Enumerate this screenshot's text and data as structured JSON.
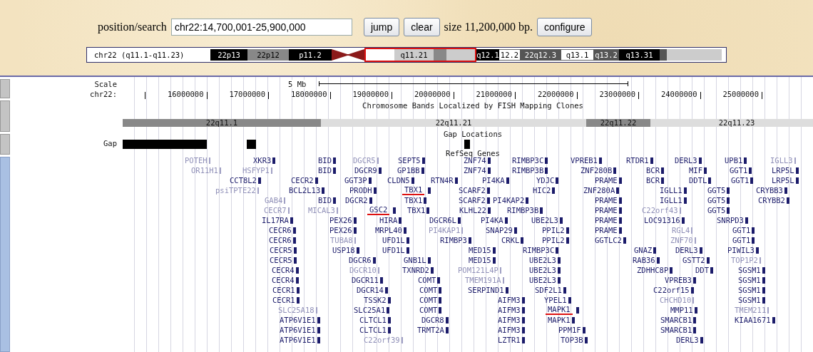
{
  "position_bar": {
    "label": "position/search",
    "value": "chr22:14,700,001-25,900,000",
    "buttons": [
      "jump",
      "clear"
    ],
    "size_text": "size 11,200,000 bp.",
    "configure_button": "configure"
  },
  "ideogram": {
    "label": "chr22 (q11.1-q11.23)",
    "bands": [
      {
        "kind": "band",
        "label": "22p13",
        "color": "#000000"
      },
      {
        "kind": "band",
        "label": "22p12",
        "color": "#888888"
      },
      {
        "kind": "band",
        "label": "p11.2",
        "color": "#000000"
      },
      {
        "kind": "centromere",
        "color": "#8b1a1a"
      },
      {
        "kind": "frame",
        "color": "#dd1111",
        "bands": [
          {
            "label": "q11.21",
            "color": "#cccccc"
          },
          {
            "color": "#888888"
          },
          {
            "color": "#cccccc"
          }
        ]
      },
      {
        "kind": "band",
        "label": "q12.1",
        "color": "#000000"
      },
      {
        "kind": "band",
        "label": "12.2",
        "color": "#ffffff"
      },
      {
        "kind": "band",
        "label": "22q12.3",
        "color": "#555555"
      },
      {
        "kind": "band",
        "label": "q13.1",
        "color": "#ffffff"
      },
      {
        "kind": "band",
        "label": "q13.2",
        "color": "#555555"
      },
      {
        "kind": "band",
        "label": "q13.31",
        "color": "#000000"
      },
      {
        "kind": "band",
        "color": "#555555"
      },
      {
        "kind": "band",
        "color": "#cccccc"
      }
    ]
  },
  "ruler": {
    "scale_label": "Scale",
    "scale_text": "5 Mb",
    "chrom_label": "chr22:",
    "ticks": [
      "16000000",
      "17000000",
      "18000000",
      "19000000",
      "20000000",
      "21000000",
      "22000000",
      "23000000",
      "24000000",
      "25000000"
    ]
  },
  "bands_track": {
    "title": "Chromosome Bands Localized by FISH Mapping Clones",
    "bands": [
      {
        "label": "22q11.1",
        "color": "#888888"
      },
      {
        "label": "22q11.21",
        "color": "#dddddd"
      },
      {
        "label": "22q11.22",
        "color": "#888888"
      },
      {
        "label": "22q11.23",
        "color": "#dddddd"
      }
    ]
  },
  "gap_track": {
    "title": "Gap Locations",
    "label": "Gap"
  },
  "genes_track": {
    "title": "RefSeq Genes",
    "rows": [
      [
        {
          "name": "POTEH",
          "faded": true,
          "marked": false
        },
        {
          "name": "XKR3",
          "faded": false,
          "marked": false
        },
        {
          "name": "BID",
          "faded": false,
          "marked": false
        },
        {
          "name": "DGCR5",
          "faded": true,
          "marked": false
        },
        {
          "name": "SEPT5",
          "faded": false,
          "marked": false
        },
        {
          "name": "ZNF74",
          "faded": false,
          "marked": false
        },
        {
          "name": "RIMBP3C",
          "faded": false,
          "marked": false
        },
        {
          "name": "VPREB1",
          "faded": false,
          "marked": false
        },
        {
          "name": "RTDR1",
          "faded": false,
          "marked": false
        },
        {
          "name": "DERL3",
          "faded": false,
          "marked": false
        },
        {
          "name": "UPB1",
          "faded": false,
          "marked": false
        },
        {
          "name": "IGLL3",
          "faded": true,
          "marked": false
        }
      ],
      [
        {
          "name": "OR11H1",
          "faded": true,
          "marked": false
        },
        {
          "name": "HSFYP1",
          "faded": true,
          "marked": false
        },
        {
          "name": "BID",
          "faded": false,
          "marked": false
        },
        {
          "name": "DGCR9",
          "faded": false,
          "marked": false
        },
        {
          "name": "GP1BB",
          "faded": false,
          "marked": false
        },
        {
          "name": "ZNF74",
          "faded": false,
          "marked": false
        },
        {
          "name": "RIMBP3B",
          "faded": false,
          "marked": false
        },
        {
          "name": "ZNF280B",
          "faded": false,
          "marked": false
        },
        {
          "name": "BCR",
          "faded": false,
          "marked": false
        },
        {
          "name": "MIF",
          "faded": false,
          "marked": false
        },
        {
          "name": "GGT1",
          "faded": false,
          "marked": false
        },
        {
          "name": "LRP5L",
          "faded": false,
          "marked": false
        }
      ],
      [
        {
          "name": "CCT8L2",
          "faded": false,
          "marked": false
        },
        {
          "name": "CECR2",
          "faded": false,
          "marked": false
        },
        {
          "name": "GGT3P",
          "faded": false,
          "marked": false
        },
        {
          "name": "CLDN5",
          "faded": false,
          "marked": false
        },
        {
          "name": "RTN4R",
          "faded": false,
          "marked": false
        },
        {
          "name": "PI4KA",
          "faded": false,
          "marked": false
        },
        {
          "name": "YDJC",
          "faded": false,
          "marked": false
        },
        {
          "name": "PRAME",
          "faded": false,
          "marked": false
        },
        {
          "name": "BCR",
          "faded": false,
          "marked": false
        },
        {
          "name": "DDTL",
          "faded": false,
          "marked": false
        },
        {
          "name": "GGT1",
          "faded": false,
          "marked": false
        },
        {
          "name": "LRP5L",
          "faded": false,
          "marked": false
        }
      ],
      [
        {
          "name": "psiTPTE22",
          "faded": true,
          "marked": false
        },
        {
          "name": "BCL2L13",
          "faded": false,
          "marked": false
        },
        {
          "name": "PRODH",
          "faded": false,
          "marked": false
        },
        {
          "name": "TBX1",
          "faded": false,
          "marked": true
        },
        {
          "name": "SCARF2",
          "faded": false,
          "marked": false
        },
        {
          "name": "HIC2",
          "faded": false,
          "marked": false
        },
        {
          "name": "ZNF280A",
          "faded": false,
          "marked": false
        },
        {
          "name": "IGLL1",
          "faded": false,
          "marked": false
        },
        {
          "name": "GGT5",
          "faded": false,
          "marked": false
        },
        {
          "name": "CRYBB3",
          "faded": false,
          "marked": false
        }
      ],
      [
        {
          "name": "GAB4",
          "faded": true,
          "marked": false
        },
        {
          "name": "BID",
          "faded": false,
          "marked": false
        },
        {
          "name": "DGCR2",
          "faded": false,
          "marked": false
        },
        {
          "name": "TBX1",
          "faded": false,
          "marked": false
        },
        {
          "name": "SCARF2",
          "faded": false,
          "marked": false
        },
        {
          "name": "PI4KAP2",
          "faded": false,
          "marked": false
        },
        {
          "name": "PRAME",
          "faded": false,
          "marked": false
        },
        {
          "name": "IGLL1",
          "faded": false,
          "marked": false
        },
        {
          "name": "GGT5",
          "faded": false,
          "marked": false
        },
        {
          "name": "CRYBB2",
          "faded": false,
          "marked": false
        }
      ],
      [
        {
          "name": "CECR7",
          "faded": true,
          "marked": false
        },
        {
          "name": "MICAL3",
          "faded": true,
          "marked": false
        },
        {
          "name": "GSC2",
          "faded": false,
          "marked": true
        },
        {
          "name": "TBX1",
          "faded": false,
          "marked": false
        },
        {
          "name": "KLHL22",
          "faded": false,
          "marked": false
        },
        {
          "name": "RIMBP3B",
          "faded": false,
          "marked": false
        },
        {
          "name": "PRAME",
          "faded": false,
          "marked": false
        },
        {
          "name": "C22orf43",
          "faded": true,
          "marked": false
        },
        {
          "name": "GGT5",
          "faded": false,
          "marked": false
        }
      ],
      [
        {
          "name": "IL17RA",
          "faded": false,
          "marked": false
        },
        {
          "name": "PEX26",
          "faded": false,
          "marked": false
        },
        {
          "name": "HIRA",
          "faded": false,
          "marked": false
        },
        {
          "name": "DGCR6L",
          "faded": false,
          "marked": false
        },
        {
          "name": "PI4KA",
          "faded": false,
          "marked": false
        },
        {
          "name": "UBE2L3",
          "faded": false,
          "marked": false
        },
        {
          "name": "PRAME",
          "faded": false,
          "marked": false
        },
        {
          "name": "LOC91316",
          "faded": false,
          "marked": false
        },
        {
          "name": "SNRPD3",
          "faded": false,
          "marked": false
        }
      ],
      [
        {
          "name": "CECR6",
          "faded": false,
          "marked": false
        },
        {
          "name": "PEX26",
          "faded": false,
          "marked": false
        },
        {
          "name": "MRPL40",
          "faded": false,
          "marked": false
        },
        {
          "name": "PI4KAP1",
          "faded": true,
          "marked": false
        },
        {
          "name": "SNAP29",
          "faded": false,
          "marked": false
        },
        {
          "name": "PPIL2",
          "faded": false,
          "marked": false
        },
        {
          "name": "PRAME",
          "faded": false,
          "marked": false
        },
        {
          "name": "RGL4",
          "faded": true,
          "marked": false
        },
        {
          "name": "GGT1",
          "faded": false,
          "marked": false
        }
      ],
      [
        {
          "name": "CECR6",
          "faded": false,
          "marked": false
        },
        {
          "name": "TUBA8",
          "faded": true,
          "marked": false
        },
        {
          "name": "UFD1L",
          "faded": false,
          "marked": false
        },
        {
          "name": "RIMBP3",
          "faded": false,
          "marked": false
        },
        {
          "name": "CRKL",
          "faded": false,
          "marked": false
        },
        {
          "name": "PPIL2",
          "faded": false,
          "marked": false
        },
        {
          "name": "GGTLC2",
          "faded": false,
          "marked": false
        },
        {
          "name": "ZNF70",
          "faded": true,
          "marked": false
        },
        {
          "name": "GGT1",
          "faded": false,
          "marked": false
        }
      ],
      [
        {
          "name": "CECR5",
          "faded": false,
          "marked": false
        },
        {
          "name": "USP18",
          "faded": false,
          "marked": false
        },
        {
          "name": "UFD1L",
          "faded": false,
          "marked": false
        },
        {
          "name": "MED15",
          "faded": false,
          "marked": false
        },
        {
          "name": "RIMBP3C",
          "faded": false,
          "marked": false
        },
        {
          "name": "GNAZ",
          "faded": false,
          "marked": false
        },
        {
          "name": "DERL3",
          "faded": false,
          "marked": false
        },
        {
          "name": "PIWIL3",
          "faded": false,
          "marked": false
        }
      ],
      [
        {
          "name": "CECR5",
          "faded": false,
          "marked": false
        },
        {
          "name": "DGCR6",
          "faded": false,
          "marked": false
        },
        {
          "name": "GNB1L",
          "faded": false,
          "marked": false
        },
        {
          "name": "MED15",
          "faded": false,
          "marked": false
        },
        {
          "name": "UBE2L3",
          "faded": false,
          "marked": false
        },
        {
          "name": "RAB36",
          "faded": false,
          "marked": false
        },
        {
          "name": "GSTT2",
          "faded": false,
          "marked": false
        },
        {
          "name": "TOP1P2",
          "faded": true,
          "marked": false
        }
      ],
      [
        {
          "name": "CECR4",
          "faded": false,
          "marked": false
        },
        {
          "name": "DGCR10",
          "faded": true,
          "marked": false
        },
        {
          "name": "TXNRD2",
          "faded": false,
          "marked": false
        },
        {
          "name": "POM121L4P",
          "faded": true,
          "marked": false
        },
        {
          "name": "UBE2L3",
          "faded": false,
          "marked": false
        },
        {
          "name": "ZDHHC8P",
          "faded": false,
          "marked": false
        },
        {
          "name": "DDT",
          "faded": false,
          "marked": false
        },
        {
          "name": "SGSM1",
          "faded": false,
          "marked": false
        }
      ],
      [
        {
          "name": "CECR4",
          "faded": false,
          "marked": false
        },
        {
          "name": "DGCR11",
          "faded": false,
          "marked": false
        },
        {
          "name": "COMT",
          "faded": false,
          "marked": false
        },
        {
          "name": "TMEM191A",
          "faded": true,
          "marked": false
        },
        {
          "name": "UBE2L3",
          "faded": false,
          "marked": false
        },
        {
          "name": "VPREB3",
          "faded": false,
          "marked": false
        },
        {
          "name": "SGSM1",
          "faded": false,
          "marked": false
        }
      ],
      [
        {
          "name": "CECR1",
          "faded": false,
          "marked": false
        },
        {
          "name": "DGCR14",
          "faded": false,
          "marked": false
        },
        {
          "name": "COMT",
          "faded": false,
          "marked": false
        },
        {
          "name": "SERPIND1",
          "faded": false,
          "marked": false
        },
        {
          "name": "SDF2L1",
          "faded": false,
          "marked": false
        },
        {
          "name": "C22orf15",
          "faded": false,
          "marked": false
        },
        {
          "name": "SGSM1",
          "faded": false,
          "marked": false
        }
      ],
      [
        {
          "name": "CECR1",
          "faded": false,
          "marked": false
        },
        {
          "name": "TSSK2",
          "faded": false,
          "marked": false
        },
        {
          "name": "COMT",
          "faded": false,
          "marked": false
        },
        {
          "name": "AIFM3",
          "faded": false,
          "marked": false
        },
        {
          "name": "YPEL1",
          "faded": false,
          "marked": false
        },
        {
          "name": "CHCHD10",
          "faded": true,
          "marked": false
        },
        {
          "name": "SGSM1",
          "faded": false,
          "marked": false
        }
      ],
      [
        {
          "name": "SLC25A18",
          "faded": true,
          "marked": false
        },
        {
          "name": "SLC25A1",
          "faded": false,
          "marked": false
        },
        {
          "name": "COMT",
          "faded": false,
          "marked": false
        },
        {
          "name": "AIFM3",
          "faded": false,
          "marked": false
        },
        {
          "name": "MAPK1",
          "faded": false,
          "marked": true
        },
        {
          "name": "MMP11",
          "faded": false,
          "marked": false
        },
        {
          "name": "TMEM211",
          "faded": true,
          "marked": false
        }
      ],
      [
        {
          "name": "ATP6V1E1",
          "faded": false,
          "marked": false
        },
        {
          "name": "CLTCL1",
          "faded": false,
          "marked": false
        },
        {
          "name": "DGCR8",
          "faded": false,
          "marked": false
        },
        {
          "name": "AIFM3",
          "faded": false,
          "marked": false
        },
        {
          "name": "MAPK1",
          "faded": false,
          "marked": false
        },
        {
          "name": "SMARCB1",
          "faded": false,
          "marked": false
        },
        {
          "name": "KIAA1671",
          "faded": false,
          "marked": false
        }
      ],
      [
        {
          "name": "ATP6V1E1",
          "faded": false,
          "marked": false
        },
        {
          "name": "CLTCL1",
          "faded": false,
          "marked": false
        },
        {
          "name": "TRMT2A",
          "faded": false,
          "marked": false
        },
        {
          "name": "AIFM3",
          "faded": false,
          "marked": false
        },
        {
          "name": "PPM1F",
          "faded": false,
          "marked": false
        },
        {
          "name": "SMARCB1",
          "faded": false,
          "marked": false
        }
      ],
      [
        {
          "name": "ATP6V1E1",
          "faded": false,
          "marked": false
        },
        {
          "name": "C22orf39",
          "faded": true,
          "marked": false
        },
        {
          "name": "LZTR1",
          "faded": false,
          "marked": false
        },
        {
          "name": "TOP3B",
          "faded": false,
          "marked": false
        },
        {
          "name": "DERL3",
          "faded": false,
          "marked": false
        }
      ]
    ]
  }
}
